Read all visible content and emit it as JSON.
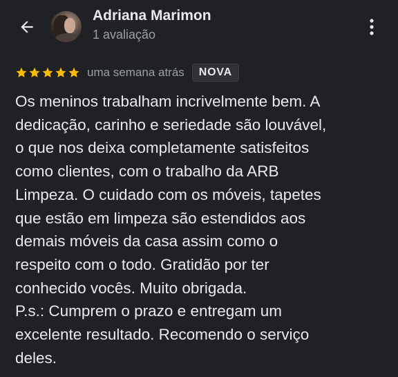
{
  "header": {
    "back_icon": "arrow-back-icon",
    "avatar_icon": "profile-photo",
    "reviewer_name": "Adriana Marimon",
    "review_count": "1 avaliação",
    "more_icon": "more-vert-icon"
  },
  "review": {
    "rating": 5,
    "max_rating": 5,
    "star_color": "#fbbc04",
    "date": "uma semana atrás",
    "badge": "NOVA",
    "text": "Os meninos trabalham incrivelmente bem. A\ndedicação, carinho e seriedade são louvável,\no que nos deixa completamente satisfeitos\ncomo clientes, com o trabalho da ARB\nLimpeza. O cuidado com os móveis, tapetes\nque estão em limpeza são estendidos aos\ndemais móveis da casa assim como o\nrespeito com o todo. Gratidão por ter\nconhecido vocês. Muito obrigada.\nP.s.: Cumprem o prazo e entregam um\nexcelente resultado. Recomendo o serviço\ndeles."
  },
  "colors": {
    "background": "#202124",
    "primary_text": "#e8eaed",
    "secondary_text": "#9aa0a6",
    "badge_background": "#303134"
  }
}
